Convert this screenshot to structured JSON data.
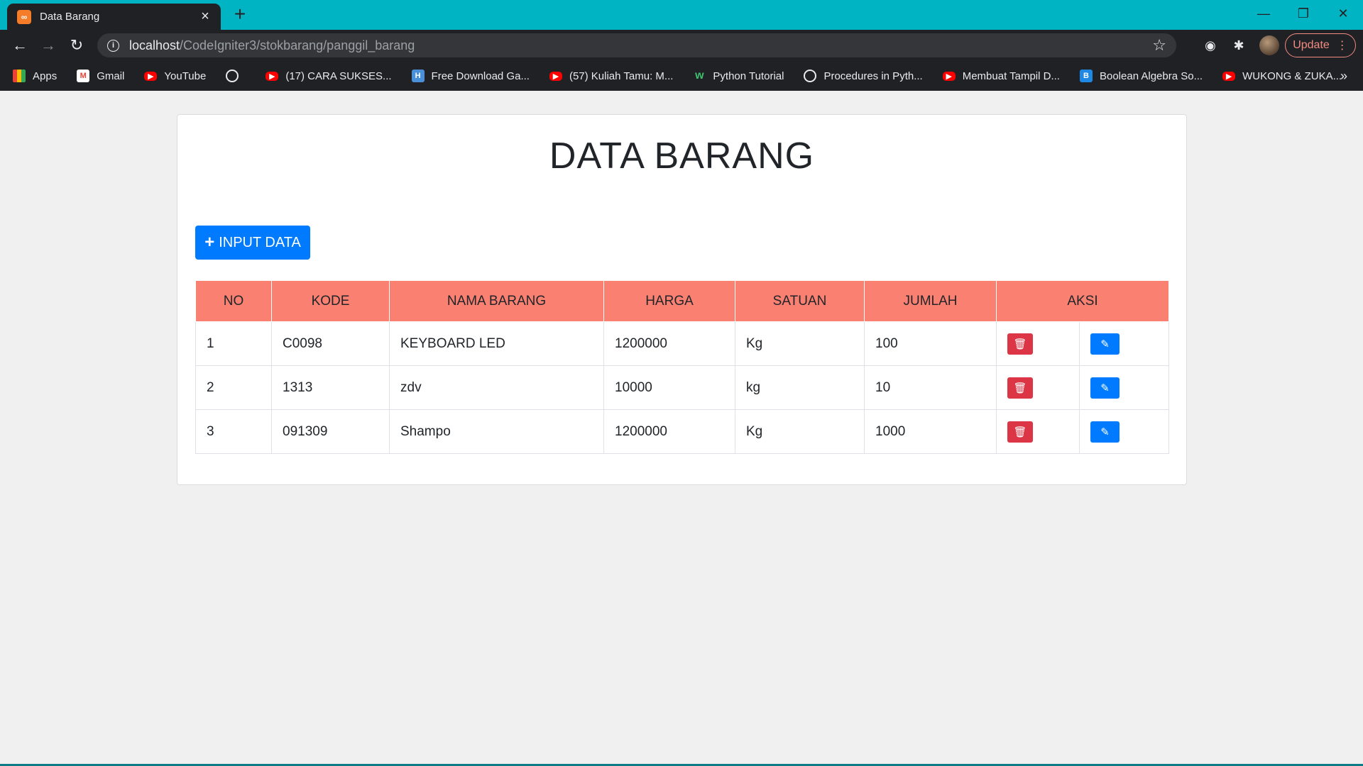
{
  "browser": {
    "tab_title": "Data Barang",
    "url_host": "localhost",
    "url_path": "/CodeIgniter3/stokbarang/panggil_barang",
    "update_label": "Update",
    "bookmarks": [
      {
        "label": "Apps",
        "icon": "apps-icon"
      },
      {
        "label": "Gmail",
        "icon": "gmail-icon"
      },
      {
        "label": "YouTube",
        "icon": "youtube-icon"
      },
      {
        "label": "",
        "icon": "globe-icon"
      },
      {
        "label": "(17) CARA SUKSES...",
        "icon": "youtube-icon"
      },
      {
        "label": "Free Download Ga...",
        "icon": "h-icon"
      },
      {
        "label": "(57) Kuliah Tamu: M...",
        "icon": "youtube-icon"
      },
      {
        "label": "Python Tutorial",
        "icon": "w-icon"
      },
      {
        "label": "Procedures in Pyth...",
        "icon": "globe-icon"
      },
      {
        "label": "Membuat Tampil D...",
        "icon": "youtube-icon"
      },
      {
        "label": "Boolean Algebra So...",
        "icon": "b-icon"
      },
      {
        "label": "WUKONG & ZUKA...",
        "icon": "youtube-icon"
      }
    ]
  },
  "page": {
    "title": "DATA BARANG",
    "input_button": "INPUT DATA",
    "columns": [
      "NO",
      "KODE",
      "NAMA BARANG",
      "HARGA",
      "SATUAN",
      "JUMLAH",
      "AKSI"
    ],
    "rows": [
      {
        "no": "1",
        "kode": "C0098",
        "nama": "KEYBOARD LED",
        "harga": "1200000",
        "satuan": "Kg",
        "jumlah": "100"
      },
      {
        "no": "2",
        "kode": "1313",
        "nama": "zdv",
        "harga": "10000",
        "satuan": "kg",
        "jumlah": "10"
      },
      {
        "no": "3",
        "kode": "091309",
        "nama": "Shampo",
        "harga": "1200000",
        "satuan": "Kg",
        "jumlah": "1000"
      }
    ]
  },
  "colors": {
    "header_row": "#fa8072",
    "primary": "#007bff",
    "danger": "#dc3545",
    "titlebar": "#00b4c3"
  }
}
